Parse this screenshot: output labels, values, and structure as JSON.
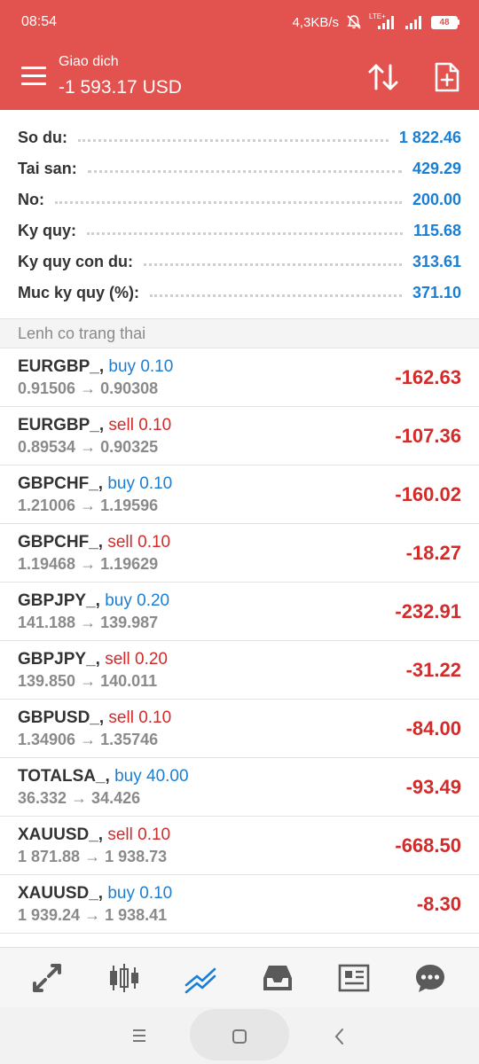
{
  "status_bar": {
    "time": "08:54",
    "network_speed": "4,3KB/s",
    "lte_label": "LTE+",
    "battery": "48"
  },
  "app_bar": {
    "title": "Giao dich",
    "subtitle": "-1 593.17 USD",
    "icons": [
      "menu-icon",
      "sort-icon",
      "new-order-icon"
    ]
  },
  "summary": [
    {
      "label": "So du:",
      "value": "1 822.46"
    },
    {
      "label": "Tai san:",
      "value": "429.29"
    },
    {
      "label": "No:",
      "value": "200.00"
    },
    {
      "label": "Ky quy:",
      "value": "115.68"
    },
    {
      "label": "Ky quy con du:",
      "value": "313.61"
    },
    {
      "label": "Muc ky quy (%):",
      "value": "371.10"
    }
  ],
  "section_title": "Lenh co trang thai",
  "positions": [
    {
      "symbol": "EURGBP_,",
      "type": "buy",
      "volume": "buy 0.10",
      "prices": "0.91506 → 0.90308",
      "profit": "-162.63"
    },
    {
      "symbol": "EURGBP_,",
      "type": "sell",
      "volume": "sell 0.10",
      "prices": "0.89534 → 0.90325",
      "profit": "-107.36"
    },
    {
      "symbol": "GBPCHF_,",
      "type": "buy",
      "volume": "buy 0.10",
      "prices": "1.21006 → 1.19596",
      "profit": "-160.02"
    },
    {
      "symbol": "GBPCHF_,",
      "type": "sell",
      "volume": "sell 0.10",
      "prices": "1.19468 → 1.19629",
      "profit": "-18.27"
    },
    {
      "symbol": "GBPJPY_,",
      "type": "buy",
      "volume": "buy 0.20",
      "prices": "141.188 → 139.987",
      "profit": "-232.91"
    },
    {
      "symbol": "GBPJPY_,",
      "type": "sell",
      "volume": "sell 0.20",
      "prices": "139.850 → 140.011",
      "profit": "-31.22"
    },
    {
      "symbol": "GBPUSD_,",
      "type": "sell",
      "volume": "sell 0.10",
      "prices": "1.34906 → 1.35746",
      "profit": "-84.00"
    },
    {
      "symbol": "TOTALSA_,",
      "type": "buy",
      "volume": "buy 40.00",
      "prices": "36.332 → 34.426",
      "profit": "-93.49"
    },
    {
      "symbol": "XAUUSD_,",
      "type": "sell",
      "volume": "sell 0.10",
      "prices": "1 871.88 → 1 938.73",
      "profit": "-668.50"
    },
    {
      "symbol": "XAUUSD_,",
      "type": "buy",
      "volume": "buy 0.10",
      "prices": "1 939.24 → 1 938.41",
      "profit": "-8.30"
    }
  ],
  "bottom_nav": [
    "quotes-icon",
    "chart-icon",
    "trade-icon",
    "history-icon",
    "news-icon",
    "chat-icon"
  ],
  "colors": {
    "accent": "#e2524f",
    "buy": "#1a7fd4",
    "sell": "#d32a2a",
    "active_tab": "#1a7fd4",
    "inactive_tab": "#5a5a5a"
  }
}
